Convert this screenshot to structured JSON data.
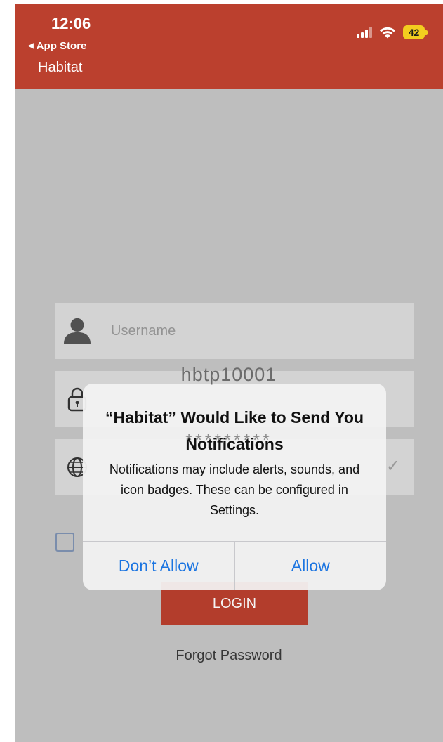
{
  "status_bar": {
    "time": "12:06",
    "back_label": "App Store",
    "battery": "42"
  },
  "header": {
    "title": "Habitat"
  },
  "login_form": {
    "username_placeholder": "Username",
    "username_value": "hbtp10001",
    "password_mask": "*********",
    "login_label": "LOGIN",
    "forgot_label": "Forgot Password"
  },
  "alert": {
    "title": "“Habitat” Would Like to Send You Notifications",
    "message": "Notifications may include alerts, sounds, and icon badges. These can be configured in Settings.",
    "deny_label": "Don’t Allow",
    "allow_label": "Allow"
  },
  "colors": {
    "brand": "#bb402e",
    "battery": "#f3cd1f",
    "alert_button": "#1a74e1",
    "background": "#c6c6c6"
  }
}
